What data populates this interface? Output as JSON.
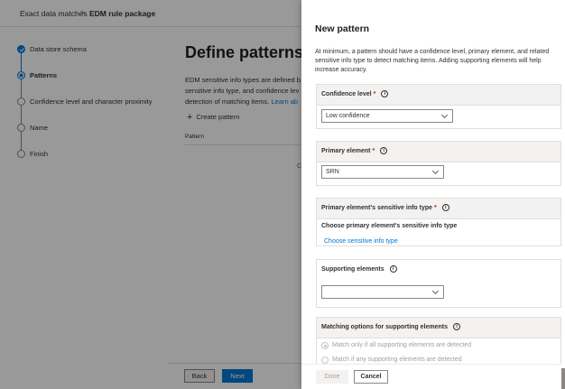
{
  "breadcrumb": {
    "parent": "Exact data matches",
    "separator": ">",
    "current": "EDM rule package"
  },
  "wizard": {
    "steps": [
      {
        "label": "Data store schema",
        "state": "done"
      },
      {
        "label": "Patterns",
        "state": "current"
      },
      {
        "label": "Confidence level and character proximity",
        "state": "pending"
      },
      {
        "label": "Name",
        "state": "pending"
      },
      {
        "label": "Finish",
        "state": "pending"
      }
    ]
  },
  "main": {
    "title": "Define patterns fo",
    "description": "EDM sensitive info types are defined b sensitive info type, and confidence lev detection of matching items.",
    "learn_more": "Learn ab",
    "create_label": "Create pattern",
    "column_header": "Pattern",
    "stray_text": "C"
  },
  "footer": {
    "back_label": "Back",
    "next_label": "Next"
  },
  "panel": {
    "title": "New pattern",
    "description": "At minimum, a pattern should have a confidence level, primary element, and related sensitive info type to detect matching items. Adding supporting elements will help increase accuracy.",
    "confidence": {
      "label": "Confidence level",
      "required": "*",
      "value": "Low confidence"
    },
    "primary_element": {
      "label": "Primary element",
      "required": "*",
      "value": "SRN"
    },
    "sensitive_info": {
      "label": "Primary element's sensitive info type",
      "required": "*",
      "sub_label": "Choose primary element's sensitive info type",
      "link": "Choose sensitive info type"
    },
    "supporting": {
      "label": "Supporting elements",
      "value": ""
    },
    "matching": {
      "label": "Matching options for supporting elements",
      "options": [
        "Match only if all supporting elements are detected",
        "Match if any supporting elements are detected"
      ],
      "selected_index": 0
    },
    "done_label": "Done",
    "cancel_label": "Cancel",
    "info_glyph": "i"
  },
  "colors": {
    "accent": "#0078d4",
    "required": "#a4262c",
    "section_header": "#f3f2f1"
  }
}
